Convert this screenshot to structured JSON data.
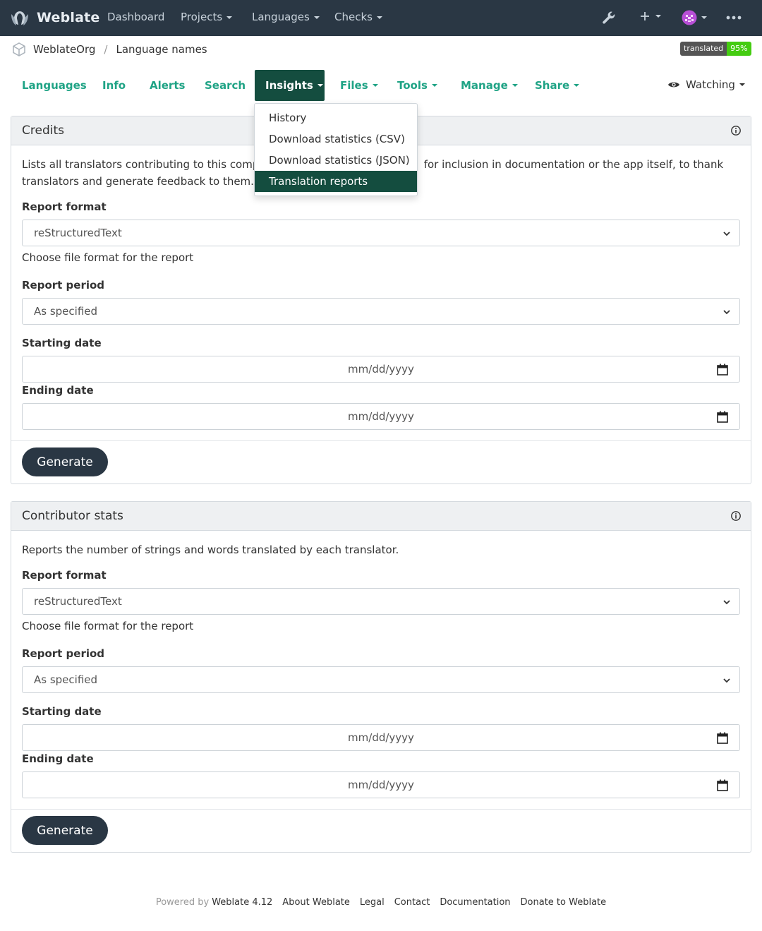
{
  "navbar": {
    "brand": "Weblate",
    "items": [
      {
        "label": "Dashboard",
        "caret": false
      },
      {
        "label": "Projects",
        "caret": true
      },
      {
        "label": "Languages",
        "caret": true
      },
      {
        "label": "Checks",
        "caret": true
      }
    ]
  },
  "breadcrumb": {
    "project": "WeblateOrg",
    "component": "Language names"
  },
  "badge": {
    "label": "translated",
    "value": "95%"
  },
  "tabs": [
    "Languages",
    "Info",
    "Alerts",
    "Search",
    "Insights",
    "Files",
    "Tools",
    "Manage",
    "Share"
  ],
  "watching": "Watching",
  "insights_menu": [
    "History",
    "Download statistics (CSV)",
    "Download statistics (JSON)",
    "Translation reports"
  ],
  "credits": {
    "title": "Credits",
    "desc_line1": "Lists all translators contributing to this compor",
    "desc_line1_end": "for inclusion in documentation or the app itself, to thank",
    "desc_line2": "translators and generate feedback to them.",
    "report_format_label": "Report format",
    "report_format_value": "reStructuredText",
    "report_format_help": "Choose file format for the report",
    "report_period_label": "Report period",
    "report_period_value": "As specified",
    "starting_date_label": "Starting date",
    "ending_date_label": "Ending date",
    "date_placeholder": "mm/dd/yyyy",
    "generate": "Generate"
  },
  "contributor": {
    "title": "Contributor stats",
    "desc": "Reports the number of strings and words translated by each translator.",
    "report_format_label": "Report format",
    "report_format_value": "reStructuredText",
    "report_format_help": "Choose file format for the report",
    "report_period_label": "Report period",
    "report_period_value": "As specified",
    "starting_date_label": "Starting date",
    "ending_date_label": "Ending date",
    "date_placeholder": "mm/dd/yyyy",
    "generate": "Generate"
  },
  "footer": {
    "powered_by": "Powered by",
    "version": "Weblate 4.12",
    "links": [
      "About Weblate",
      "Legal",
      "Contact",
      "Documentation",
      "Donate to Weblate"
    ]
  },
  "colors": {
    "navbar": "#2a3744",
    "accent": "#1fa385",
    "active_tab": "#144d3f",
    "badge_green": "#44cc11"
  }
}
